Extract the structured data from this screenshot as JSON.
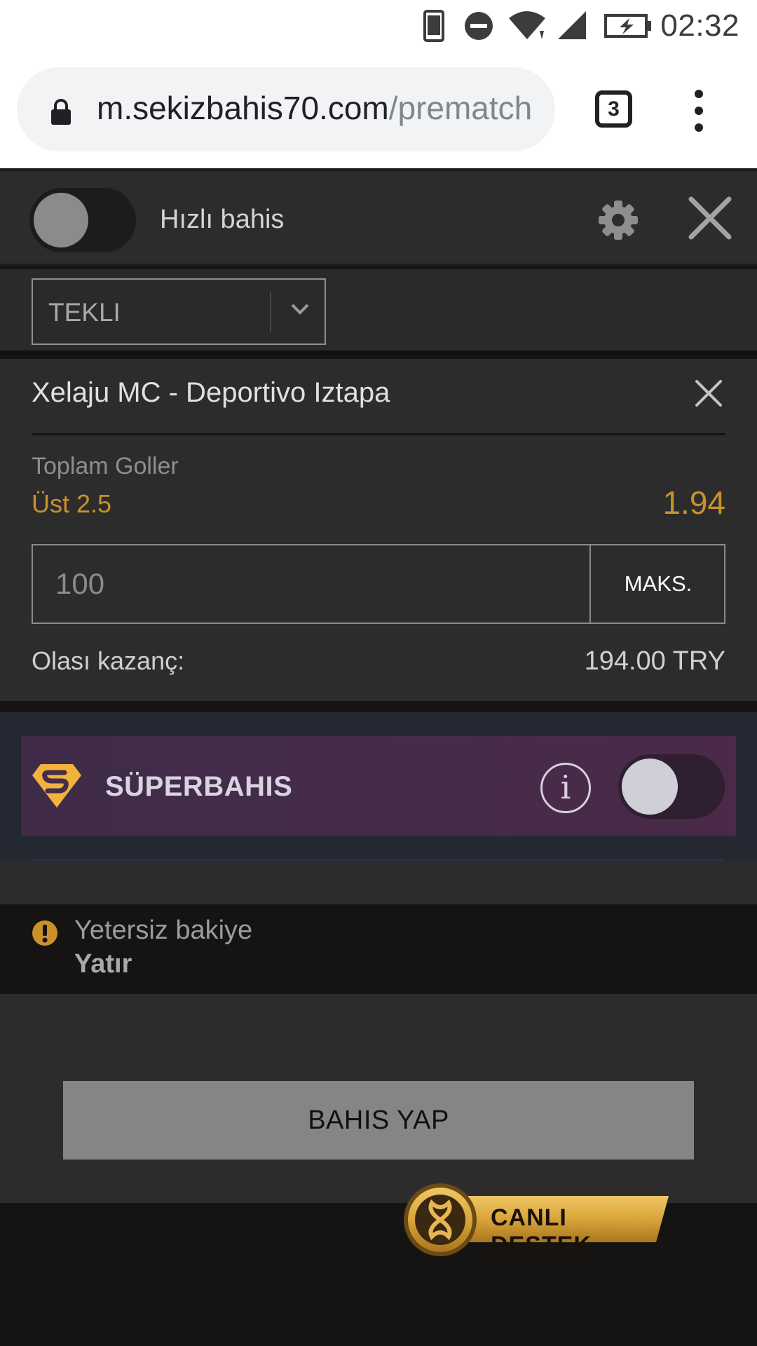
{
  "status_bar": {
    "time": "02:32",
    "icons": [
      "phone-icon",
      "do-not-disturb-icon",
      "wifi-icon",
      "signal-icon",
      "battery-charging-icon"
    ]
  },
  "browser": {
    "url_host": "m.sekizbahis70.com",
    "url_path": "/prematch",
    "tab_count": "3",
    "icons": [
      "lock-icon",
      "overflow-menu-icon"
    ]
  },
  "betslip": {
    "quick_bet_label": "Hızlı bahis",
    "quick_bet_enabled": false,
    "bet_type": "TEKLI",
    "event": "Xelaju MC - Deportivo Iztapa",
    "market": "Toplam Goller",
    "selection": "Üst 2.5",
    "odds": "1.94",
    "stake_placeholder": "100",
    "max_label": "MAKS.",
    "payout_label": "Olası kazanç:",
    "payout_value": "194.00 TRY",
    "colors": {
      "accent": "#c8912a",
      "panel": "#2d2c2c",
      "dark": "#161313"
    }
  },
  "superbahis": {
    "label": "SÜPERBAHIS",
    "info_glyph": "i",
    "enabled": false,
    "colors": {
      "logo": "#f2b33d",
      "banner": "#452c4a"
    }
  },
  "warning": {
    "text": "Yetersiz bakiye",
    "link": "Yatır",
    "color": "#c8912a"
  },
  "actions": {
    "place_bet": "BAHIS YAP"
  },
  "live_support": {
    "label_1": "CANLI",
    "label_2": "DESTEK",
    "color": "#d9a53a"
  }
}
